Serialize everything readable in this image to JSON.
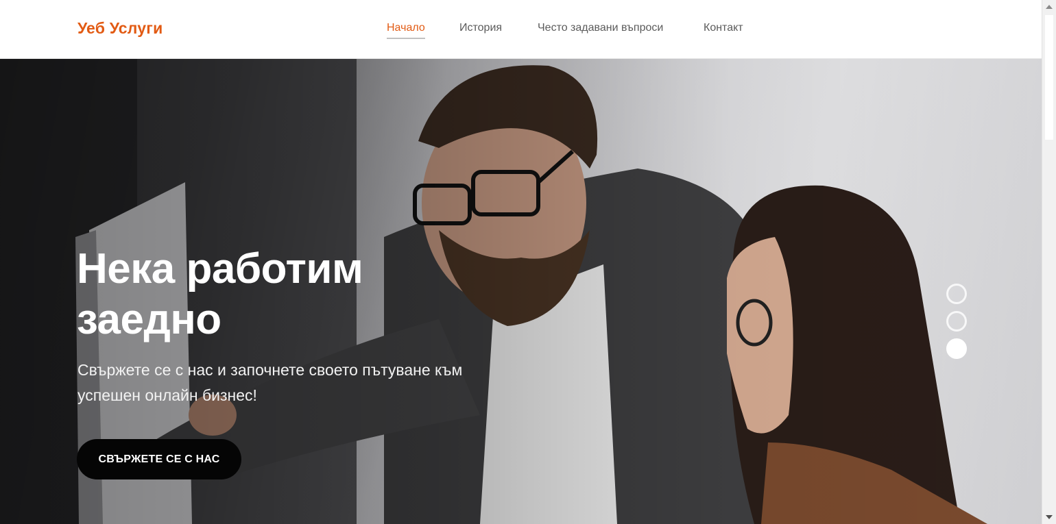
{
  "brand": {
    "name": "Уеб Услуги",
    "color": "#e25b14"
  },
  "nav": {
    "items": [
      {
        "label": "Начало",
        "active": true
      },
      {
        "label": "История",
        "active": false
      },
      {
        "label": "Често задавани въпроси",
        "active": false
      },
      {
        "label": "Контакт",
        "active": false
      }
    ]
  },
  "hero": {
    "title_line1": "Нека работим",
    "title_line2": "заедно",
    "subtitle": "Свържете се с нас и започнете своето пътуване към успешен онлайн бизнес!",
    "cta_label": "СВЪРЖЕТЕ СЕ С НАС",
    "image": "photo-two-people-at-computer-icon"
  },
  "carousel": {
    "slide_count": 3,
    "active_index": 2
  }
}
